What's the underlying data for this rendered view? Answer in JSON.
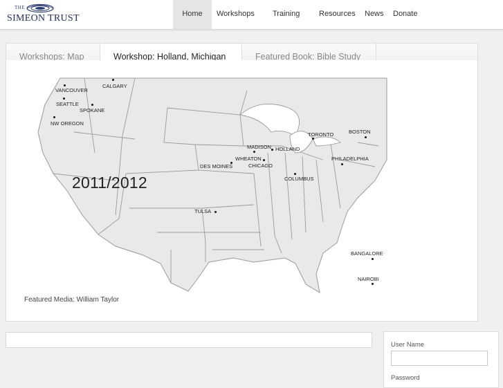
{
  "brand": {
    "the": "THE",
    "name": "SIMEON TRUST"
  },
  "nav": [
    "Home",
    "Workshops",
    "Training",
    "Resources",
    "News",
    "Donate"
  ],
  "tabs": [
    "Workshops: Map",
    "Workshop: Holland, Michigan",
    "Featured Book: Bible Study"
  ],
  "map": {
    "year": "2011/2012",
    "cities": [
      "VANCOUVER",
      "CALGARY",
      "SEATTLE",
      "SPOKANE",
      "NW OREGON",
      "TORONTO",
      "BOSTON",
      "MADISON",
      "HOLLAND",
      "WHEATON",
      "CHICAGO",
      "PHILADELPHIA",
      "DES MOINES",
      "COLUMBUS",
      "TULSA",
      "BANGALORE",
      "NAIROBI"
    ]
  },
  "featured_media": "Featured Media: William Taylor",
  "login": {
    "username_label": "User Name",
    "password_label": "Password"
  },
  "colors": {
    "brand_navy": "#1e2d66",
    "map_fill": "#e9e9e9",
    "map_stroke": "#9a9a9a"
  }
}
